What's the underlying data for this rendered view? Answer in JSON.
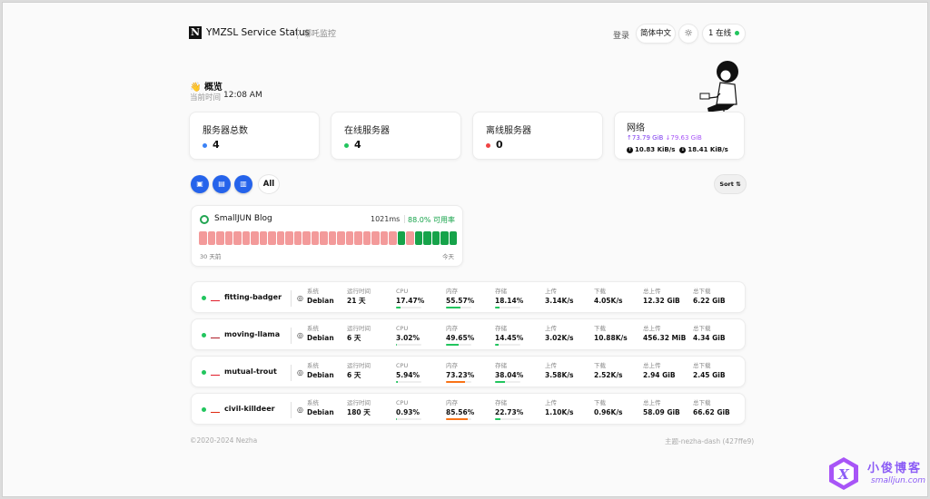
{
  "header": {
    "logo_letter": "N",
    "title": "YMZSL Service Status",
    "subtitle": "哪吒监控",
    "login": "登录",
    "language": "简体中文",
    "theme_icon": "sun-icon",
    "online_label": "1 在线"
  },
  "overview": {
    "emoji": "👋",
    "title": "概览",
    "time_label": "当前时间",
    "time": "12:08 AM"
  },
  "stats": {
    "total": {
      "label": "服务器总数",
      "value": "4",
      "color": "#3b82f6"
    },
    "online": {
      "label": "在线服务器",
      "value": "4",
      "color": "#22c55e"
    },
    "offline": {
      "label": "离线服务器",
      "value": "0",
      "color": "#ef4444"
    },
    "network": {
      "label": "网络",
      "upload_total": "↑73.79 GiB",
      "download_total": "↓79.63 GiB",
      "upload_speed": "10.83 KiB/s",
      "download_speed": "18.41 KiB/s"
    }
  },
  "filters": {
    "buttons": [
      "server-icon",
      "chart-icon",
      "columns-icon"
    ],
    "all_label": "All",
    "sort_label": "Sort ⇅"
  },
  "monitor": {
    "name": "SmallJUN Blog",
    "latency": "1021ms",
    "uptime": "88.0% 可用率",
    "range_start": "30 天前",
    "range_end": "今天",
    "days": [
      "down",
      "down",
      "down",
      "down",
      "down",
      "down",
      "down",
      "down",
      "down",
      "down",
      "down",
      "down",
      "down",
      "down",
      "down",
      "down",
      "down",
      "down",
      "down",
      "down",
      "down",
      "down",
      "down",
      "up",
      "down",
      "up",
      "up",
      "up",
      "up",
      "up"
    ],
    "colors": {
      "up": "#16a34a",
      "down": "#f39a9a"
    }
  },
  "servers": [
    {
      "name": "fitting-badger",
      "flag": "ch",
      "os_label": "系统",
      "os": "Debian",
      "uptime_label": "运行时间",
      "uptime": "21 天",
      "cpu_label": "CPU",
      "cpu": "17.47%",
      "cpu_pct": 17.47,
      "mem_label": "内存",
      "mem": "55.57%",
      "mem_pct": 55.57,
      "disk_label": "存储",
      "disk": "18.14%",
      "disk_pct": 18.14,
      "up_label": "上传",
      "up": "3.14K/s",
      "down_label": "下载",
      "down": "4.05K/s",
      "tup_label": "总上传",
      "tup": "12.32 GiB",
      "tdown_label": "总下载",
      "tdown": "6.22 GiB"
    },
    {
      "name": "moving-llama",
      "flag": "nl",
      "os_label": "系统",
      "os": "Debian",
      "uptime_label": "运行时间",
      "uptime": "6 天",
      "cpu_label": "CPU",
      "cpu": "3.02%",
      "cpu_pct": 3.02,
      "mem_label": "内存",
      "mem": "49.65%",
      "mem_pct": 49.65,
      "disk_label": "存储",
      "disk": "14.45%",
      "disk_pct": 14.45,
      "up_label": "上传",
      "up": "3.02K/s",
      "down_label": "下载",
      "down": "10.88K/s",
      "tup_label": "总上传",
      "tup": "456.32 MiB",
      "tdown_label": "总下载",
      "tdown": "4.34 GiB"
    },
    {
      "name": "mutual-trout",
      "flag": "ch",
      "os_label": "系统",
      "os": "Debian",
      "uptime_label": "运行时间",
      "uptime": "6 天",
      "cpu_label": "CPU",
      "cpu": "5.94%",
      "cpu_pct": 5.94,
      "mem_label": "内存",
      "mem": "73.23%",
      "mem_pct": 73.23,
      "disk_label": "存储",
      "disk": "38.04%",
      "disk_pct": 38.04,
      "up_label": "上传",
      "up": "3.58K/s",
      "down_label": "下载",
      "down": "2.52K/s",
      "tup_label": "总上传",
      "tup": "2.94 GiB",
      "tdown_label": "总下载",
      "tdown": "2.45 GiB"
    },
    {
      "name": "civil-killdeer",
      "flag": "cn",
      "os_label": "系统",
      "os": "Debian",
      "uptime_label": "运行时间",
      "uptime": "180 天",
      "cpu_label": "CPU",
      "cpu": "0.93%",
      "cpu_pct": 0.93,
      "mem_label": "内存",
      "mem": "85.56%",
      "mem_pct": 85.56,
      "disk_label": "存储",
      "disk": "22.73%",
      "disk_pct": 22.73,
      "up_label": "上传",
      "up": "1.10K/s",
      "down_label": "下载",
      "down": "0.96K/s",
      "tup_label": "总上传",
      "tup": "58.09 GiB",
      "tdown_label": "总下载",
      "tdown": "66.62 GiB"
    }
  ],
  "footer": {
    "copyright": "©2020-2024 Nezha",
    "theme": "主题-nezha-dash (427ffe9)"
  },
  "watermark": {
    "title": "小俊博客",
    "url": "smalljun.com"
  }
}
